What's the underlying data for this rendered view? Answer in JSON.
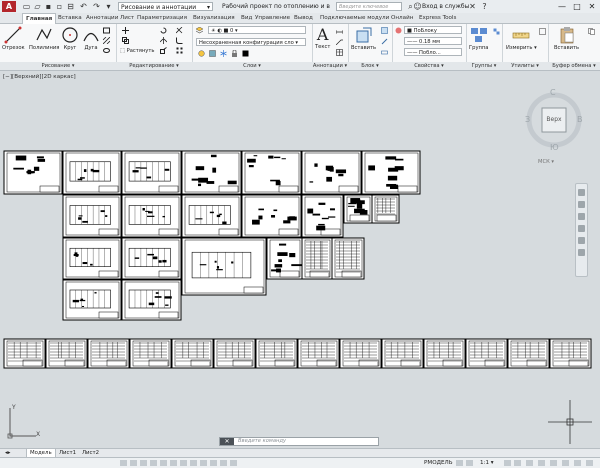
{
  "app": {
    "logo": "A",
    "workspace": "Рисование и аннотации",
    "doc_title": "Рабочий проект по  отоплению и ве...",
    "search_placeholder": "Введите ключевое слово/фразу",
    "sign_in": "Вход в службы",
    "window_buttons": [
      "—",
      "□",
      "✕"
    ]
  },
  "tabs": [
    "Главная",
    "Вставка",
    "Аннотации",
    "Лист",
    "Параметризация",
    "Визуализация",
    "Вид",
    "Управление",
    "Вывод",
    "Подключаемые модули",
    "Онлайн",
    "Express Tools"
  ],
  "ribbon": {
    "draw": {
      "label": "Рисование",
      "tools": [
        "Отрезок",
        "Полилиния",
        "Круг",
        "Дуга"
      ]
    },
    "modify": {
      "label": "Редактирование",
      "stretch": "Растянуть"
    },
    "layers": {
      "label": "Слои",
      "current_layer": "Несохраненная конфигурация сло"
    },
    "annotation": {
      "label": "Аннотации",
      "text": "Текст"
    },
    "block": {
      "label": "Блок",
      "insert": "Вставить"
    },
    "properties": {
      "label": "Свойства",
      "color": "ПоБлоку",
      "lineweight": "0.18 мм",
      "linetype": "Побло..."
    },
    "groups": {
      "label": "Группы",
      "group": "Группа"
    },
    "utilities": {
      "label": "Утилиты",
      "measure": "Измерить"
    },
    "clipboard": {
      "label": "Буфер обмена",
      "paste": "Вставить"
    }
  },
  "viewport": {
    "label": "[−][Верхний][2D каркас]"
  },
  "viewcube": {
    "north": "С",
    "south": "Ю",
    "west": "З",
    "east": "В",
    "face": "Верх",
    "ucs": "МСК"
  },
  "ucs_icon": {
    "x": "X",
    "y": "Y"
  },
  "command_line": {
    "close": "✕",
    "placeholder": "Введите команду"
  },
  "layout_tabs": [
    "Модель",
    "Лист1",
    "Лист2"
  ],
  "status": {
    "mode": "РМОДЕЛЬ",
    "scale": "1:1"
  },
  "colors": {
    "accent": "#b3262b",
    "model_bg": "#d6dbde"
  }
}
